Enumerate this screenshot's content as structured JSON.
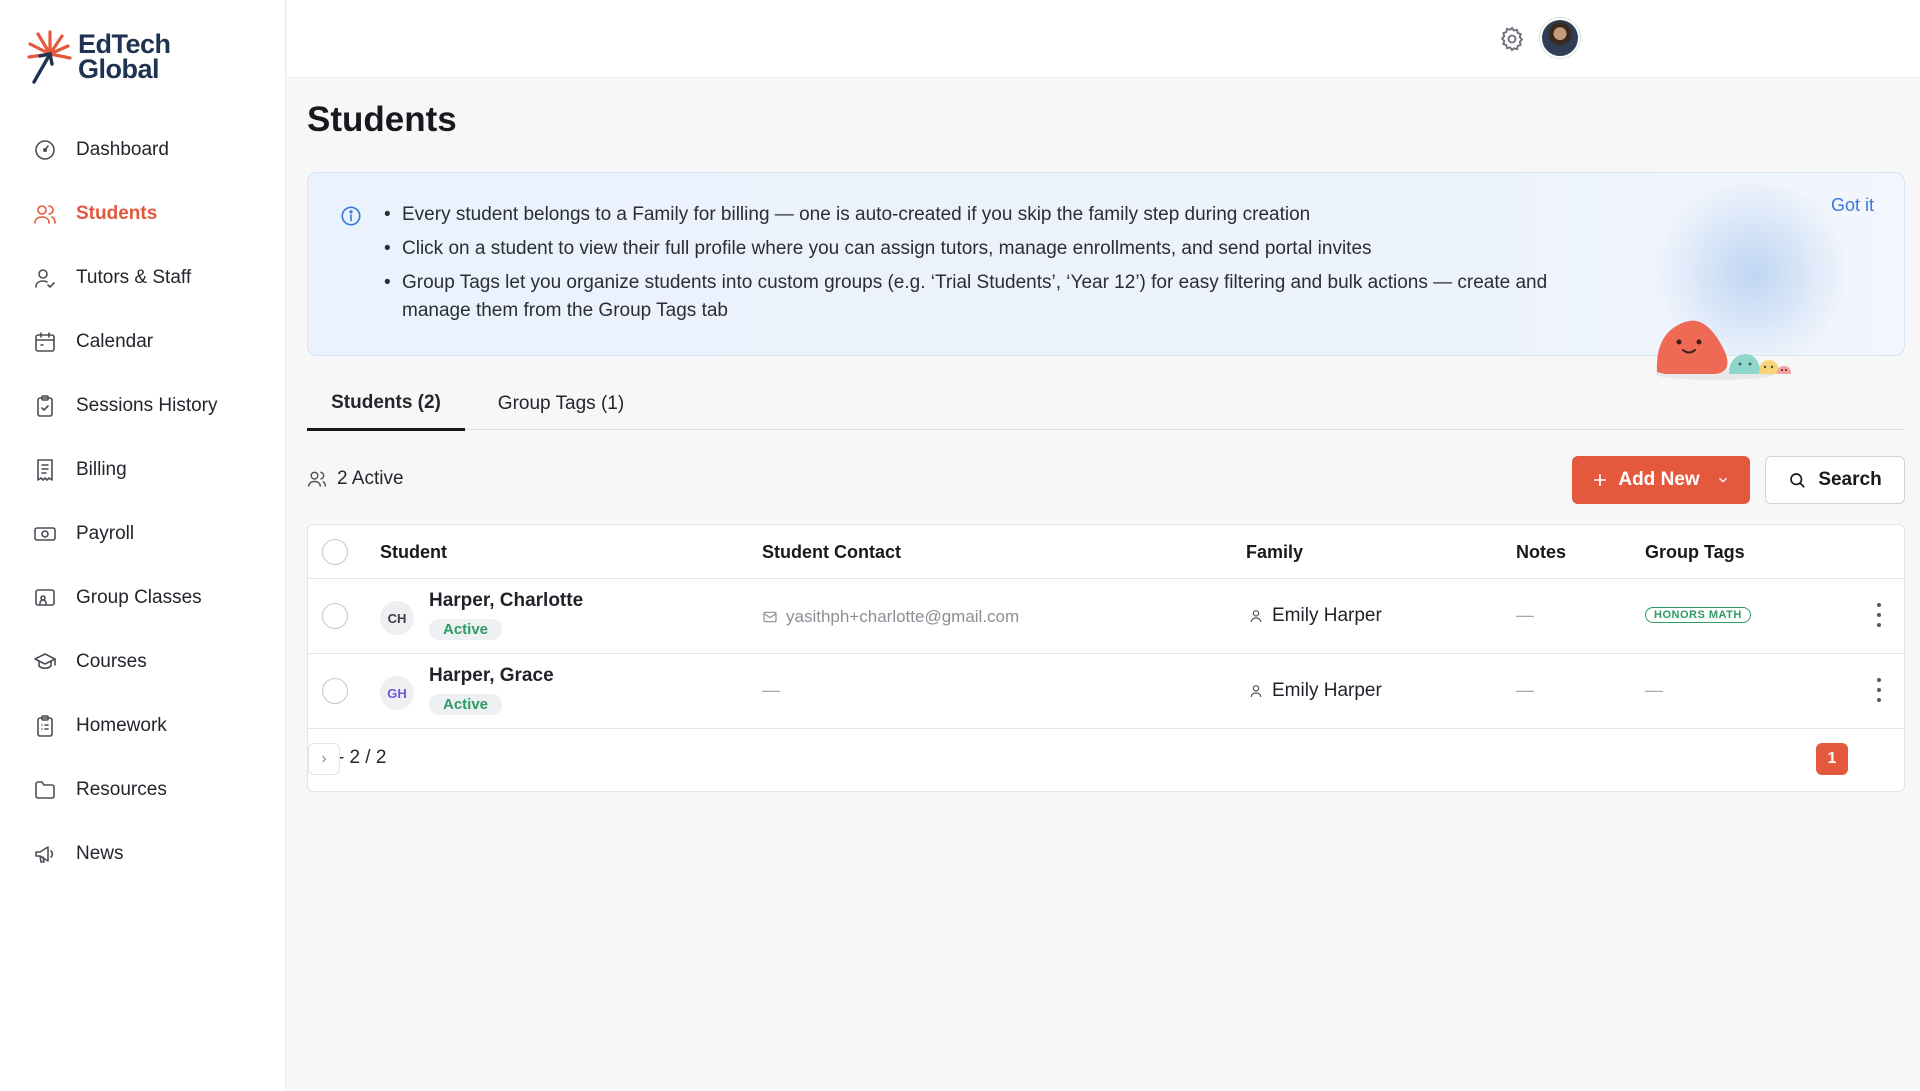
{
  "brand": {
    "line1": "EdTech",
    "line2": "Global",
    "accent": "#e4583e",
    "navy": "#1e3352"
  },
  "sidebar": {
    "items": [
      {
        "label": "Dashboard",
        "icon": "dashboard-gauge-icon"
      },
      {
        "label": "Students",
        "icon": "users-icon",
        "active": true
      },
      {
        "label": "Tutors & Staff",
        "icon": "user-check-icon"
      },
      {
        "label": "Calendar",
        "icon": "calendar-icon"
      },
      {
        "label": "Sessions History",
        "icon": "clipboard-check-icon"
      },
      {
        "label": "Billing",
        "icon": "receipt-icon"
      },
      {
        "label": "Payroll",
        "icon": "banknote-icon"
      },
      {
        "label": "Group Classes",
        "icon": "group-screen-icon"
      },
      {
        "label": "Courses",
        "icon": "graduation-cap-icon"
      },
      {
        "label": "Homework",
        "icon": "clipboard-list-icon"
      },
      {
        "label": "Resources",
        "icon": "folder-icon"
      },
      {
        "label": "News",
        "icon": "megaphone-icon"
      }
    ]
  },
  "header": {
    "settings_icon": "gear-icon",
    "avatar_icon": "user-avatar"
  },
  "page": {
    "title": "Students"
  },
  "info": {
    "bullets": [
      "Every student belongs to a Family for billing — one is auto-created if you skip the family step during creation",
      "Click on a student to view their full profile where you can assign tutors, manage enrollments, and send portal invites",
      "Group Tags let you organize students into custom groups (e.g. ‘Trial Students’, ‘Year 12’) for easy filtering and bulk actions — create and manage them from the Group Tags tab"
    ],
    "dismiss": "Got it"
  },
  "tabs": [
    {
      "label": "Students (2)",
      "active": true
    },
    {
      "label": "Group Tags (1)",
      "active": false
    }
  ],
  "toolbar": {
    "active_count": "2 Active",
    "add_label": "Add New",
    "search_label": "Search"
  },
  "table": {
    "columns": [
      "Student",
      "Student Contact",
      "Family",
      "Notes",
      "Group Tags"
    ],
    "rows": [
      {
        "initials": "CH",
        "name": "Harper, Charlotte",
        "status": "Active",
        "contact": "yasithph+charlotte@gmail.com",
        "family": "Emily Harper",
        "notes": "—",
        "tags": "HONORS MATH"
      },
      {
        "initials": "GH",
        "name": "Harper, Grace",
        "status": "Active",
        "contact": "—",
        "family": "Emily Harper",
        "notes": "—",
        "tags": "—"
      }
    ],
    "range": "1 - 2 / 2",
    "page": "1"
  }
}
